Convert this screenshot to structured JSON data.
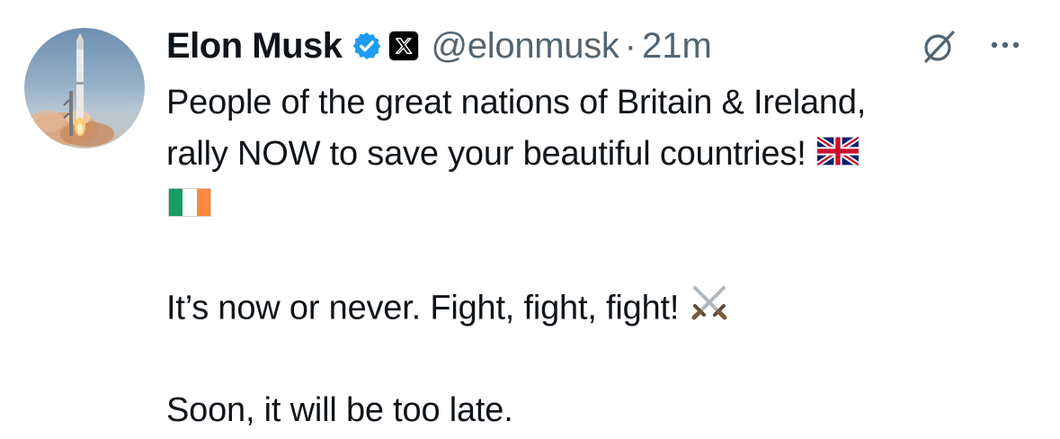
{
  "tweet": {
    "display_name": "Elon Musk",
    "handle": "@elonmusk",
    "separator": "·",
    "time": "21m",
    "verified_icon": "verified-badge-icon",
    "affiliation_icon": "x-logo-icon",
    "avatar_icon": "rocket-launch-avatar",
    "grok_icon": "grok-icon",
    "more_icon": "more-options-icon",
    "brand_color": "#1d9bf0",
    "text_color": "#0f1419",
    "muted_color": "#536471",
    "text_lines": [
      "People of the great nations of Britain & Ireland,",
      "rally NOW to save your beautiful countries!",
      "It’s now or never. Fight, fight, fight!",
      "Soon, it will be too late."
    ],
    "emojis": {
      "uk_flag": "uk-flag-emoji",
      "ireland_flag": "ireland-flag-emoji",
      "crossed_swords": "crossed-swords-emoji"
    }
  }
}
